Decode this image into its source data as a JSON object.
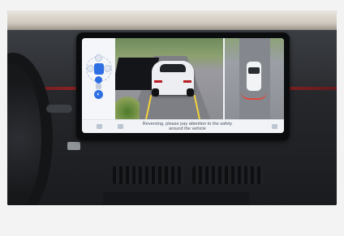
{
  "screen": {
    "status_message": "Reversing, please pay attention to the safety around the vehicle"
  },
  "icons": {
    "view_selector": "camera-view-dial-icon",
    "vehicle": "car-icon",
    "settings": "gear-icon",
    "close": "close-icon"
  },
  "colors": {
    "accent": "#2f6fe4",
    "trim": "#b3272b",
    "guide_lines": "#f3d33b"
  }
}
